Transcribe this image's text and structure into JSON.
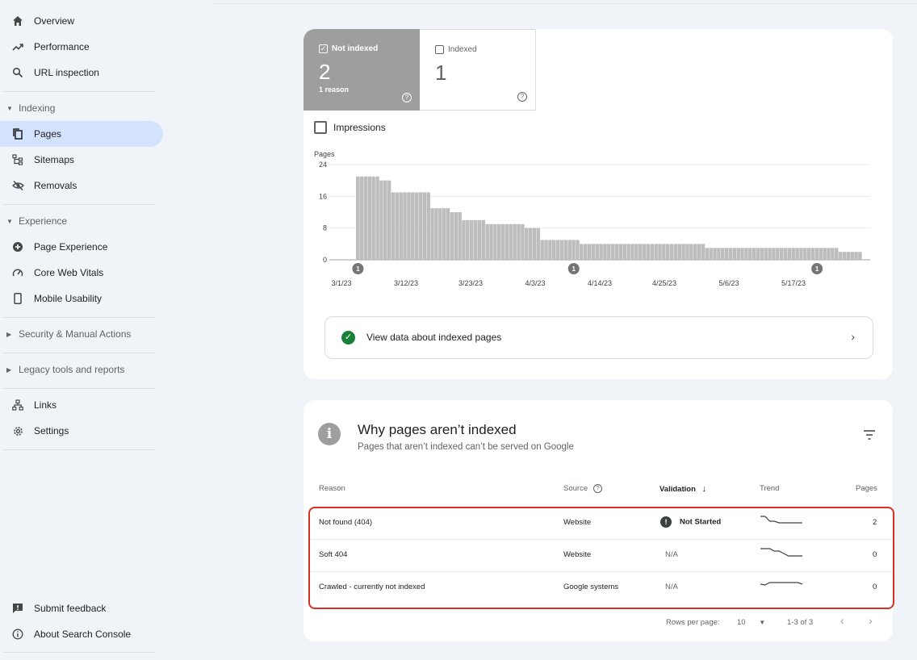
{
  "sidebar": {
    "items": [
      {
        "label": "Overview",
        "icon": "home-icon"
      },
      {
        "label": "Performance",
        "icon": "trending-up-icon"
      },
      {
        "label": "URL inspection",
        "icon": "search-icon"
      }
    ],
    "indexing": {
      "heading": "Indexing",
      "items": [
        {
          "label": "Pages",
          "icon": "pages-icon",
          "active": true
        },
        {
          "label": "Sitemaps",
          "icon": "sitemap-icon"
        },
        {
          "label": "Removals",
          "icon": "eye-off-icon"
        }
      ]
    },
    "experience": {
      "heading": "Experience",
      "items": [
        {
          "label": "Page Experience",
          "icon": "plus-circle-icon"
        },
        {
          "label": "Core Web Vitals",
          "icon": "gauge-icon"
        },
        {
          "label": "Mobile Usability",
          "icon": "phone-icon"
        }
      ]
    },
    "security_heading": "Security & Manual Actions",
    "legacy_heading": "Legacy tools and reports",
    "bottom_items": [
      {
        "label": "Links",
        "icon": "network-icon"
      },
      {
        "label": "Settings",
        "icon": "gear-icon"
      }
    ],
    "footer_items": [
      {
        "label": "Submit feedback",
        "icon": "feedback-icon"
      },
      {
        "label": "About Search Console",
        "icon": "info-icon"
      }
    ]
  },
  "summary": {
    "not_indexed": {
      "label": "Not indexed",
      "value": "2",
      "sub": "1 reason",
      "checked": true
    },
    "indexed": {
      "label": "Indexed",
      "value": "1",
      "checked": false
    },
    "impressions_label": "Impressions"
  },
  "chart_data": {
    "type": "bar",
    "ylabel": "Pages",
    "ylim": [
      0,
      24
    ],
    "yticks": [
      0,
      8,
      16,
      24
    ],
    "x_tick_labels": [
      "3/1/23",
      "3/12/23",
      "3/23/23",
      "4/3/23",
      "4/14/23",
      "4/25/23",
      "5/6/23",
      "5/17/23"
    ],
    "values": [
      21,
      21,
      21,
      21,
      21,
      21,
      20,
      20,
      20,
      17,
      17,
      17,
      17,
      17,
      17,
      17,
      17,
      17,
      17,
      13,
      13,
      13,
      13,
      13,
      12,
      12,
      12,
      10,
      10,
      10,
      10,
      10,
      10,
      9,
      9,
      9,
      9,
      9,
      9,
      9,
      9,
      9,
      9,
      8,
      8,
      8,
      8,
      5,
      5,
      5,
      5,
      5,
      5,
      5,
      5,
      5,
      5,
      4,
      4,
      4,
      4,
      4,
      4,
      4,
      4,
      4,
      4,
      4,
      4,
      4,
      4,
      4,
      4,
      4,
      4,
      4,
      4,
      4,
      4,
      4,
      4,
      4,
      4,
      4,
      4,
      4,
      4,
      4,
      4,
      3,
      3,
      3,
      3,
      3,
      3,
      3,
      3,
      3,
      3,
      3,
      3,
      3,
      3,
      3,
      3,
      3,
      3,
      3,
      3,
      3,
      3,
      3,
      3,
      3,
      3,
      3,
      3,
      3,
      3,
      3,
      3,
      3,
      3,
      2,
      2,
      2,
      2,
      2,
      2
    ],
    "annotations": [
      {
        "label": "1",
        "index": 0
      },
      {
        "label": "1",
        "index": 55
      },
      {
        "label": "1",
        "index": 117
      }
    ],
    "grid": true,
    "color": "#bdbdbd"
  },
  "view_indexed": "View data about indexed pages",
  "why": {
    "title": "Why pages aren’t indexed",
    "subtitle": "Pages that aren’t indexed can’t be served on Google",
    "columns": {
      "reason": "Reason",
      "source": "Source",
      "validation": "Validation",
      "trend": "Trend",
      "pages": "Pages"
    },
    "rows": [
      {
        "reason": "Not found (404)",
        "source": "Website",
        "validation": "Not Started",
        "validation_state": "warning",
        "pages": "2",
        "trend": [
          0,
          0,
          6,
          6,
          8,
          8,
          8,
          8,
          8,
          8
        ]
      },
      {
        "reason": "Soft 404",
        "source": "Website",
        "validation": "N/A",
        "validation_state": "na",
        "pages": "0",
        "trend": [
          0,
          0,
          0,
          3,
          3,
          6,
          9,
          9,
          9,
          9
        ]
      },
      {
        "reason": "Crawled - currently not indexed",
        "source": "Google systems",
        "validation": "N/A",
        "validation_state": "na",
        "pages": "0",
        "trend": [
          4,
          5,
          2,
          2,
          2,
          2,
          2,
          2,
          2,
          4
        ]
      }
    ],
    "pager": {
      "rows_per_page_label": "Rows per page:",
      "rows_per_page": "10",
      "range": "1-3 of 3"
    }
  }
}
